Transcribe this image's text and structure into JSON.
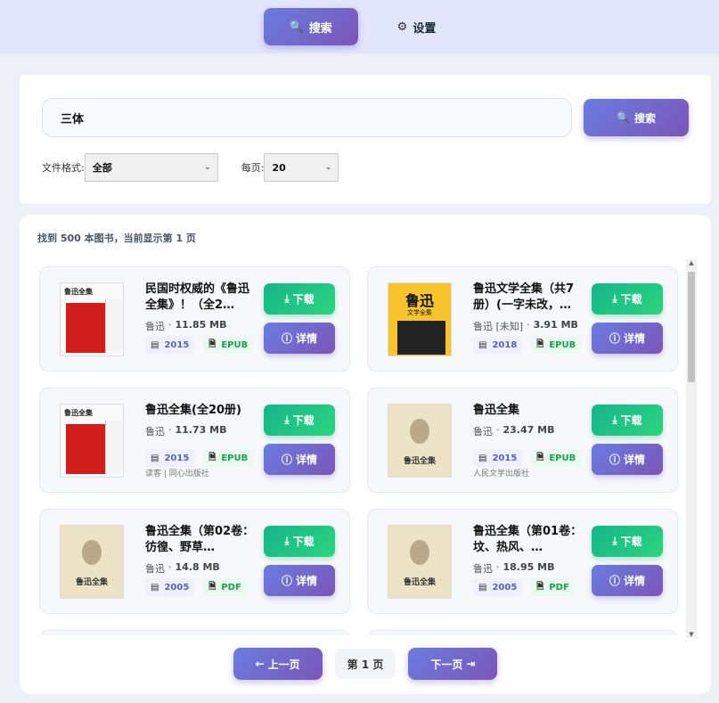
{
  "nav": {
    "search_label": "搜索",
    "settings_label": "设置"
  },
  "search": {
    "query": "三体",
    "button_label": "搜索",
    "format_label": "文件格式:",
    "format_value": "全部",
    "perpage_label": "每页:",
    "perpage_value": "20"
  },
  "results": {
    "summary": "找到 500 本图书，当前显示第 1 页",
    "download_label": "下载",
    "detail_label": "详情",
    "books": [
      {
        "title": "民国时权威的《鲁迅全集》！（全2…",
        "author": "鲁迅",
        "size": "11.85 MB",
        "year": "2015",
        "format": "EPUB",
        "publisher": "",
        "cover": "red"
      },
      {
        "title": "鲁迅文学全集（共7册）(一字未改，…",
        "author": "鲁迅 [未知]",
        "size": "3.91 MB",
        "year": "2018",
        "format": "EPUB",
        "publisher": "",
        "cover": "yellow"
      },
      {
        "title": "鲁迅全集(全20册)",
        "author": "鲁迅",
        "size": "11.73 MB",
        "year": "2015",
        "format": "EPUB",
        "publisher": "读客 | 同心出版社",
        "cover": "red"
      },
      {
        "title": "鲁迅全集",
        "author": "鲁迅",
        "size": "23.47 MB",
        "year": "2015",
        "format": "EPUB",
        "publisher": "人民文学出版社",
        "cover": "beige"
      },
      {
        "title": "鲁迅全集（第02卷：彷徨、野草…",
        "author": "鲁迅",
        "size": "14.8 MB",
        "year": "2005",
        "format": "PDF",
        "publisher": "",
        "cover": "beige"
      },
      {
        "title": "鲁迅全集（第01卷：坟、热风、…",
        "author": "鲁迅",
        "size": "18.95 MB",
        "year": "2005",
        "format": "PDF",
        "publisher": "",
        "cover": "beige"
      }
    ]
  },
  "covers": {
    "red_label": "鲁迅全集",
    "yellow_title": "鲁迅",
    "yellow_sub": "文学全集",
    "beige_title": "鲁迅全集"
  },
  "pager": {
    "prev_label": "上一页",
    "page_label": "第 1 页",
    "next_label": "下一页"
  },
  "colors": {
    "accent": "#6b7ce0",
    "accent2": "#7b56b8",
    "download": "#1fc185",
    "epub": "#16a34a"
  }
}
